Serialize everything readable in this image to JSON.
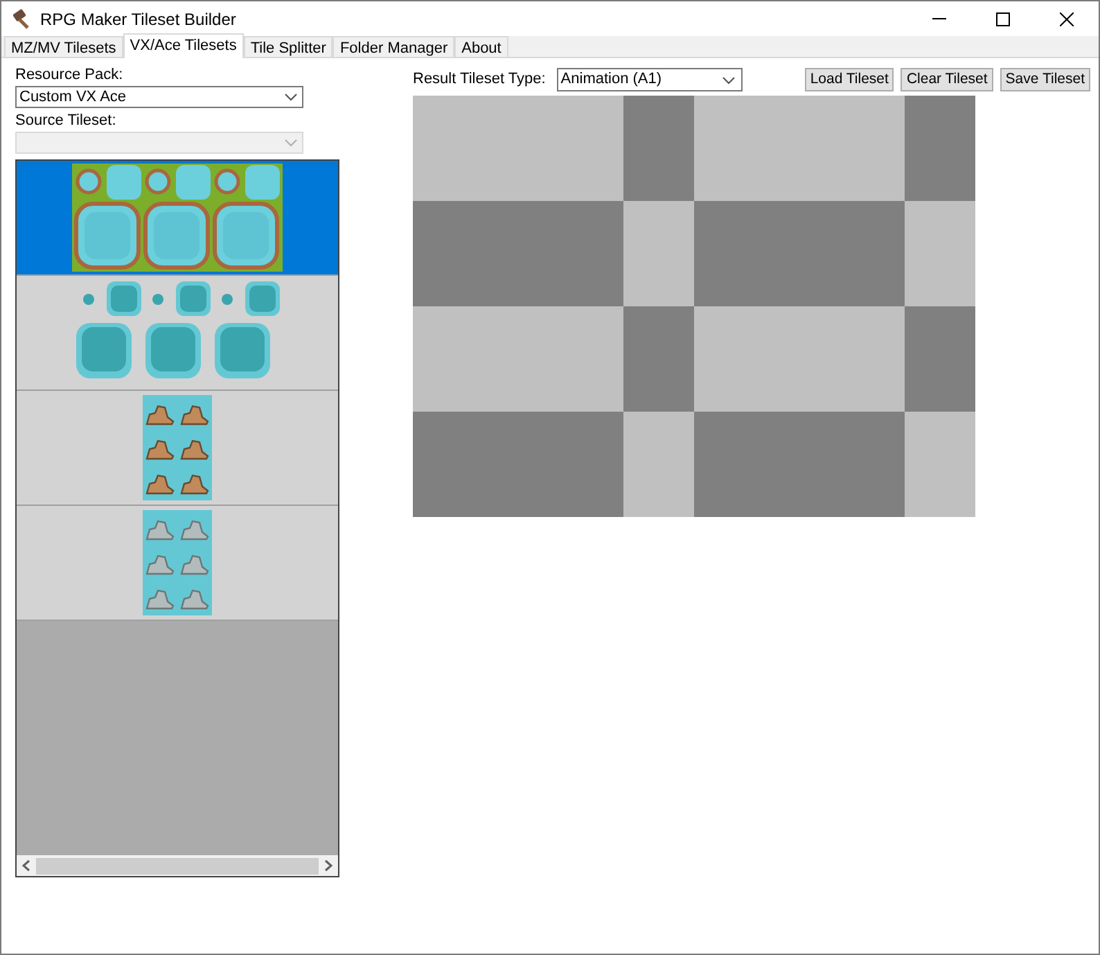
{
  "window": {
    "title": "RPG Maker Tileset Builder"
  },
  "tabs": [
    {
      "label": "MZ/MV Tilesets",
      "selected": false
    },
    {
      "label": "VX/Ace Tilesets",
      "selected": true
    },
    {
      "label": "Tile Splitter",
      "selected": false
    },
    {
      "label": "Folder Manager",
      "selected": false
    },
    {
      "label": "About",
      "selected": false
    }
  ],
  "resource_pack": {
    "label": "Resource Pack:",
    "value": "Custom VX Ace"
  },
  "source_tileset": {
    "label": "Source Tileset:",
    "disabled": true
  },
  "tileset_list": [
    {
      "kind": "water-grass",
      "selected": true
    },
    {
      "kind": "water-deep",
      "selected": false
    },
    {
      "kind": "rock-brown",
      "selected": false
    },
    {
      "kind": "rock-grey",
      "selected": false
    }
  ],
  "result_type": {
    "label": "Result Tileset Type:",
    "value": "Animation (A1)"
  },
  "buttons": [
    "Load Tileset",
    "Clear Tileset",
    "Save Tileset"
  ]
}
